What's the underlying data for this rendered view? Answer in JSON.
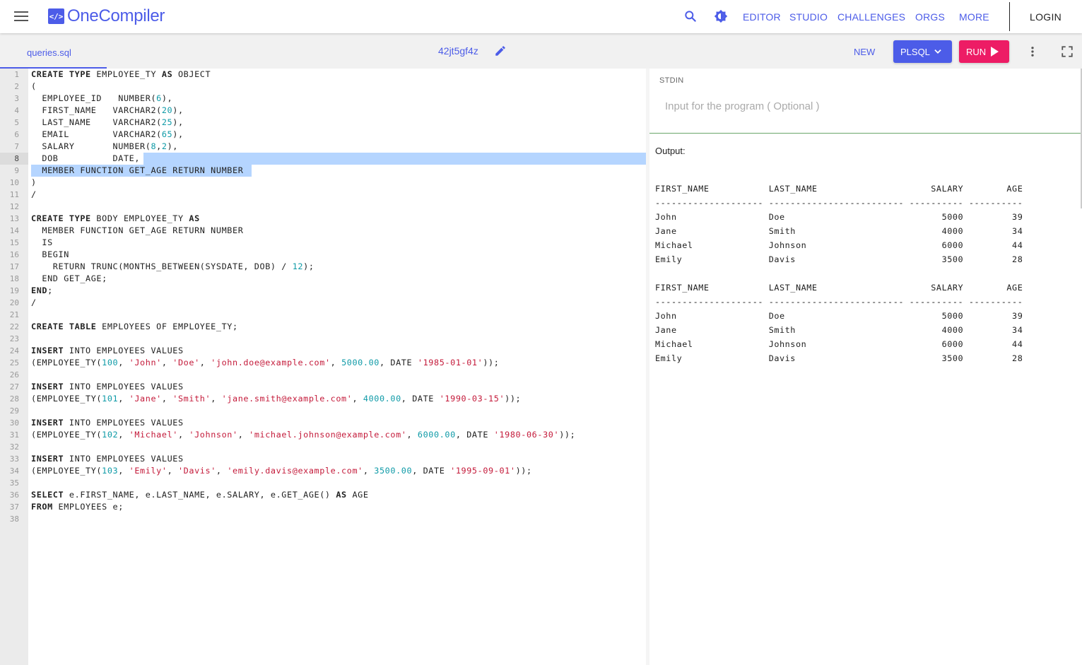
{
  "nav": {
    "brand": "OneCompiler",
    "brand_icon": "</>",
    "links": [
      "EDITOR",
      "STUDIO",
      "CHALLENGES",
      "ORGS",
      "MORE"
    ],
    "login": "LOGIN",
    "accent_color": "#4c5ce8"
  },
  "toolbar": {
    "file_tab": "queries.sql",
    "file_id": "42jt5gf4z",
    "new_label": "NEW",
    "language_label": "PLSQL",
    "run_label": "RUN",
    "run_color": "#ed1c65"
  },
  "editor": {
    "line_count": 38,
    "active_line": 8,
    "lines": [
      [
        [
          "kw",
          "CREATE TYPE"
        ],
        [
          "t",
          " EMPLOYEE_TY "
        ],
        [
          "kw",
          "AS"
        ],
        [
          "t",
          " OBJECT"
        ]
      ],
      [
        [
          "t",
          "("
        ]
      ],
      [
        [
          "t",
          "  EMPLOYEE_ID   NUMBER("
        ],
        [
          "num",
          "6"
        ],
        [
          "t",
          "),"
        ]
      ],
      [
        [
          "t",
          "  FIRST_NAME   VARCHAR2("
        ],
        [
          "num",
          "20"
        ],
        [
          "t",
          "),"
        ]
      ],
      [
        [
          "t",
          "  LAST_NAME    VARCHAR2("
        ],
        [
          "num",
          "25"
        ],
        [
          "t",
          "),"
        ]
      ],
      [
        [
          "t",
          "  EMAIL        VARCHAR2("
        ],
        [
          "num",
          "65"
        ],
        [
          "t",
          "),"
        ]
      ],
      [
        [
          "t",
          "  SALARY       NUMBER("
        ],
        [
          "num",
          "8"
        ],
        [
          "t",
          ","
        ],
        [
          "num",
          "2"
        ],
        [
          "t",
          "),"
        ]
      ],
      [
        [
          "t",
          "  DOB          DATE,"
        ]
      ],
      [
        [
          "t",
          "  MEMBER FUNCTION GET_AGE RETURN NUMBER"
        ]
      ],
      [
        [
          "t",
          ")"
        ]
      ],
      [
        [
          "t",
          "/"
        ]
      ],
      [
        [
          "t",
          ""
        ]
      ],
      [
        [
          "kw",
          "CREATE TYPE"
        ],
        [
          "t",
          " BODY EMPLOYEE_TY "
        ],
        [
          "kw",
          "AS"
        ]
      ],
      [
        [
          "t",
          "  MEMBER FUNCTION GET_AGE RETURN NUMBER"
        ]
      ],
      [
        [
          "t",
          "  IS"
        ]
      ],
      [
        [
          "t",
          "  BEGIN"
        ]
      ],
      [
        [
          "t",
          "    RETURN TRUNC(MONTHS_BETWEEN(SYSDATE, DOB) / "
        ],
        [
          "num",
          "12"
        ],
        [
          "t",
          ");"
        ]
      ],
      [
        [
          "t",
          "  END GET_AGE;"
        ]
      ],
      [
        [
          "kw",
          "END"
        ],
        [
          "t",
          ";"
        ]
      ],
      [
        [
          "t",
          "/"
        ]
      ],
      [
        [
          "t",
          ""
        ]
      ],
      [
        [
          "kw",
          "CREATE TABLE"
        ],
        [
          "t",
          " EMPLOYEES OF EMPLOYEE_TY;"
        ]
      ],
      [
        [
          "t",
          ""
        ]
      ],
      [
        [
          "kw",
          "INSERT"
        ],
        [
          "t",
          " INTO EMPLOYEES VALUES"
        ]
      ],
      [
        [
          "t",
          "(EMPLOYEE_TY("
        ],
        [
          "num",
          "100"
        ],
        [
          "t",
          ", "
        ],
        [
          "str",
          "'John'"
        ],
        [
          "t",
          ", "
        ],
        [
          "str",
          "'Doe'"
        ],
        [
          "t",
          ", "
        ],
        [
          "str",
          "'john.doe@example.com'"
        ],
        [
          "t",
          ", "
        ],
        [
          "num",
          "5000.00"
        ],
        [
          "t",
          ", DATE "
        ],
        [
          "str",
          "'1985-01-01'"
        ],
        [
          "t",
          "));"
        ]
      ],
      [
        [
          "t",
          ""
        ]
      ],
      [
        [
          "kw",
          "INSERT"
        ],
        [
          "t",
          " INTO EMPLOYEES VALUES"
        ]
      ],
      [
        [
          "t",
          "(EMPLOYEE_TY("
        ],
        [
          "num",
          "101"
        ],
        [
          "t",
          ", "
        ],
        [
          "str",
          "'Jane'"
        ],
        [
          "t",
          ", "
        ],
        [
          "str",
          "'Smith'"
        ],
        [
          "t",
          ", "
        ],
        [
          "str",
          "'jane.smith@example.com'"
        ],
        [
          "t",
          ", "
        ],
        [
          "num",
          "4000.00"
        ],
        [
          "t",
          ", DATE "
        ],
        [
          "str",
          "'1990-03-15'"
        ],
        [
          "t",
          "));"
        ]
      ],
      [
        [
          "t",
          ""
        ]
      ],
      [
        [
          "kw",
          "INSERT"
        ],
        [
          "t",
          " INTO EMPLOYEES VALUES"
        ]
      ],
      [
        [
          "t",
          "(EMPLOYEE_TY("
        ],
        [
          "num",
          "102"
        ],
        [
          "t",
          ", "
        ],
        [
          "str",
          "'Michael'"
        ],
        [
          "t",
          ", "
        ],
        [
          "str",
          "'Johnson'"
        ],
        [
          "t",
          ", "
        ],
        [
          "str",
          "'michael.johnson@example.com'"
        ],
        [
          "t",
          ", "
        ],
        [
          "num",
          "6000.00"
        ],
        [
          "t",
          ", DATE "
        ],
        [
          "str",
          "'1980-06-30'"
        ],
        [
          "t",
          "));"
        ]
      ],
      [
        [
          "t",
          ""
        ]
      ],
      [
        [
          "kw",
          "INSERT"
        ],
        [
          "t",
          " INTO EMPLOYEES VALUES"
        ]
      ],
      [
        [
          "t",
          "(EMPLOYEE_TY("
        ],
        [
          "num",
          "103"
        ],
        [
          "t",
          ", "
        ],
        [
          "str",
          "'Emily'"
        ],
        [
          "t",
          ", "
        ],
        [
          "str",
          "'Davis'"
        ],
        [
          "t",
          ", "
        ],
        [
          "str",
          "'emily.davis@example.com'"
        ],
        [
          "t",
          ", "
        ],
        [
          "num",
          "3500.00"
        ],
        [
          "t",
          ", DATE "
        ],
        [
          "str",
          "'1995-09-01'"
        ],
        [
          "t",
          "));"
        ]
      ],
      [
        [
          "t",
          ""
        ]
      ],
      [
        [
          "kw",
          "SELECT"
        ],
        [
          "t",
          " e.FIRST_NAME, e.LAST_NAME, e.SALARY, e.GET_AGE() "
        ],
        [
          "kw",
          "AS"
        ],
        [
          "t",
          " AGE"
        ]
      ],
      [
        [
          "kw",
          "FROM"
        ],
        [
          "t",
          " EMPLOYEES e;"
        ]
      ],
      [
        [
          "t",
          ""
        ]
      ]
    ]
  },
  "stdin": {
    "label": "STDIN",
    "placeholder": "Input for the program ( Optional )",
    "value": ""
  },
  "output": {
    "label": "Output:",
    "text": "FIRST_NAME           LAST_NAME                     SALARY        AGE\n-------------------- ------------------------- ---------- ----------\nJohn                 Doe                             5000         39\nJane                 Smith                           4000         34\nMichael              Johnson                         6000         44\nEmily                Davis                           3500         28\n\nFIRST_NAME           LAST_NAME                     SALARY        AGE\n-------------------- ------------------------- ---------- ----------\nJohn                 Doe                             5000         39\nJane                 Smith                           4000         34\nMichael              Johnson                         6000         44\nEmily                Davis                           3500         28"
  }
}
